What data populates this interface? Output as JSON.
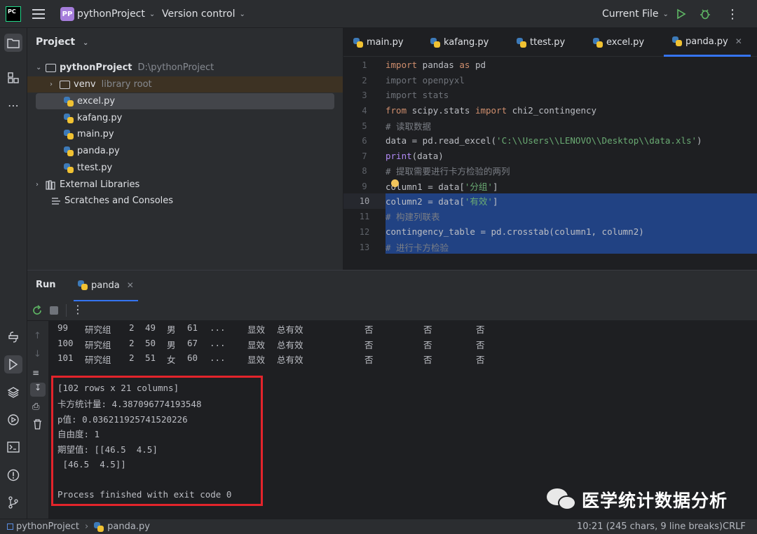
{
  "topbar": {
    "project_badge": "PP",
    "project_name": "pythonProject",
    "version_control": "Version control",
    "run_config": "Current File"
  },
  "project_panel": {
    "title": "Project",
    "root_name": "pythonProject",
    "root_path": "D:\\pythonProject",
    "items": [
      {
        "label": "venv",
        "hint": "library root"
      },
      {
        "label": "excel.py"
      },
      {
        "label": "kafang.py"
      },
      {
        "label": "main.py"
      },
      {
        "label": "panda.py"
      },
      {
        "label": "ttest.py"
      }
    ],
    "external_libraries": "External Libraries",
    "scratches": "Scratches and Consoles"
  },
  "editor": {
    "tabs": [
      {
        "label": "main.py"
      },
      {
        "label": "kafang.py"
      },
      {
        "label": "ttest.py"
      },
      {
        "label": "excel.py"
      },
      {
        "label": "panda.py",
        "active": true
      }
    ],
    "lines": [
      {
        "n": "1",
        "t1": "import",
        "t2": " pandas ",
        "t3": "as",
        "t4": " pd"
      },
      {
        "n": "2",
        "text": "import openpyxl"
      },
      {
        "n": "3",
        "text": "import stats"
      },
      {
        "n": "4",
        "t1": "from",
        "t2": " scipy.stats ",
        "t3": "import",
        "t4": " chi2_contingency"
      },
      {
        "n": "5",
        "text": "# 读取数据"
      },
      {
        "n": "6",
        "t1": "data = pd.read_excel(",
        "t2": "'C:\\\\Users\\\\LENOVO\\\\Desktop\\\\data.xls'",
        "t3": ")"
      },
      {
        "n": "7",
        "t1": "print",
        "t2": "(data)"
      },
      {
        "n": "8",
        "text": "# 提取需要进行卡方检验的两列"
      },
      {
        "n": "9",
        "t1": "column1 = data[",
        "t2": "'分组'",
        "t3": "]"
      },
      {
        "n": "10",
        "t1": "column2 = data[",
        "t2": "'有效'",
        "t3": "]"
      },
      {
        "n": "11",
        "text": "# 构建列联表"
      },
      {
        "n": "12",
        "text": "contingency_table = pd.crosstab(column1, column2)"
      },
      {
        "n": "13",
        "text": "# 进行卡方检验"
      }
    ]
  },
  "run": {
    "title": "Run",
    "tab": "panda",
    "table_rows": [
      [
        "99",
        "研究组",
        "2",
        "49",
        "男",
        "61",
        "...",
        "显效",
        "总有效",
        "否",
        "否",
        "否"
      ],
      [
        "100",
        "研究组",
        "2",
        "50",
        "男",
        "67",
        "...",
        "显效",
        "总有效",
        "否",
        "否",
        "否"
      ],
      [
        "101",
        "研究组",
        "2",
        "51",
        "女",
        "60",
        "...",
        "显效",
        "总有效",
        "否",
        "否",
        "否"
      ]
    ],
    "output": [
      "[102 rows x 21 columns]",
      "卡方统计量: 4.387096774193548",
      "p值: 0.036211925741520226",
      "自由度: 1",
      "期望值: [[46.5  4.5]",
      " [46.5  4.5]]",
      "",
      "Process finished with exit code 0"
    ]
  },
  "status": {
    "crumb_project": "pythonProject",
    "crumb_file": "panda.py",
    "position": "10:21 (245 chars, 9 line breaks)",
    "line_ending": "CRLF"
  },
  "watermark": {
    "text": "医学统计数据分析"
  }
}
